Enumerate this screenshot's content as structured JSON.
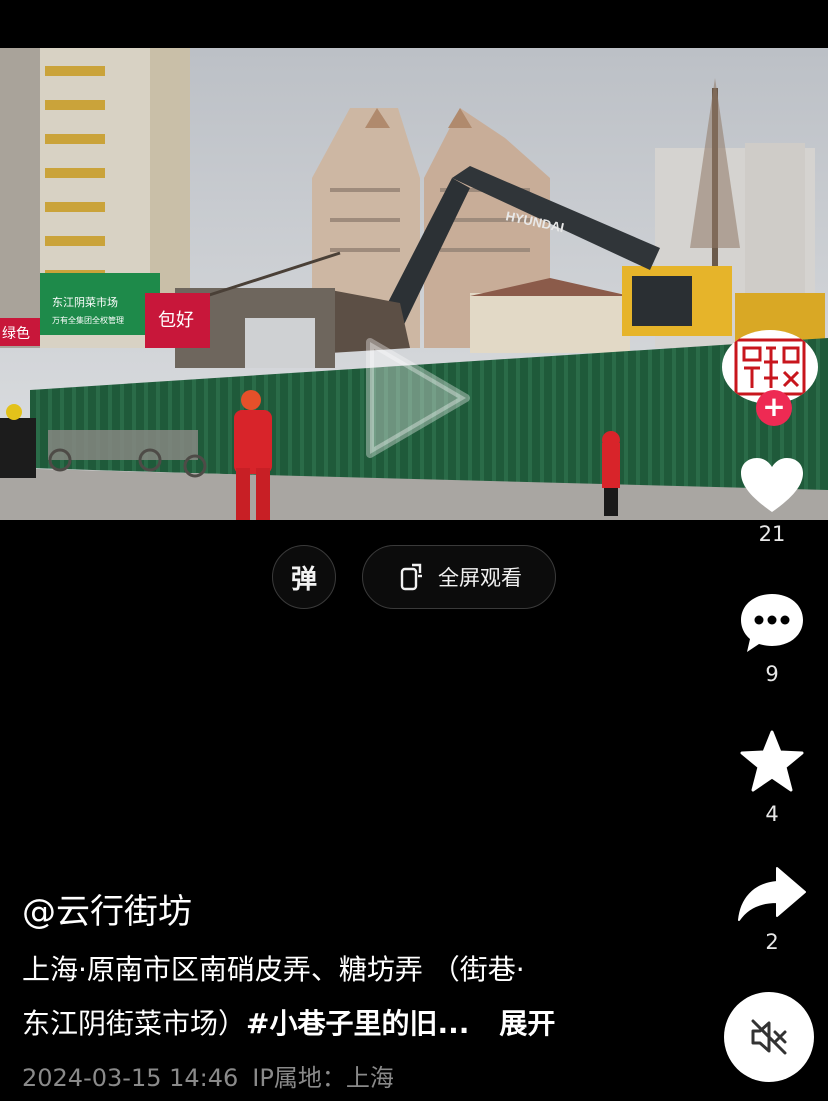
{
  "video": {
    "scene_signs": {
      "market_sign": "东江阴菜市场",
      "market_sign_sub": "万有全集团全权管理",
      "shop_sign": "包好",
      "left_sign": "绿色",
      "excavator_brand": "HYUNDAI"
    }
  },
  "controls": {
    "danmaku_label": "弹",
    "fullscreen_label": "全屏观看"
  },
  "rail": {
    "follow_label": "+",
    "like_count": "21",
    "comment_count": "9",
    "favorite_count": "4",
    "share_count": "2"
  },
  "post": {
    "author": "@云行街坊",
    "description_line1": "上海·原南市区南硝皮弄、糖坊弄 （街巷·",
    "description_line2": "东江阴街菜市场）",
    "hashtag": "#小巷子里的旧...",
    "expand_label": "展开",
    "timestamp": "2024-03-15 14:46",
    "ip_location": "IP属地：上海"
  },
  "colors": {
    "background": "#000000",
    "follow_badge": "#ee2a53",
    "fence": "#1f5a3a",
    "worker_suit": "#d8242a",
    "meta_text": "#8a8a8a"
  },
  "icons": [
    "play-icon",
    "rotate-phone-icon",
    "heart-icon",
    "comment-icon",
    "star-icon",
    "share-icon",
    "mute-icon"
  ]
}
